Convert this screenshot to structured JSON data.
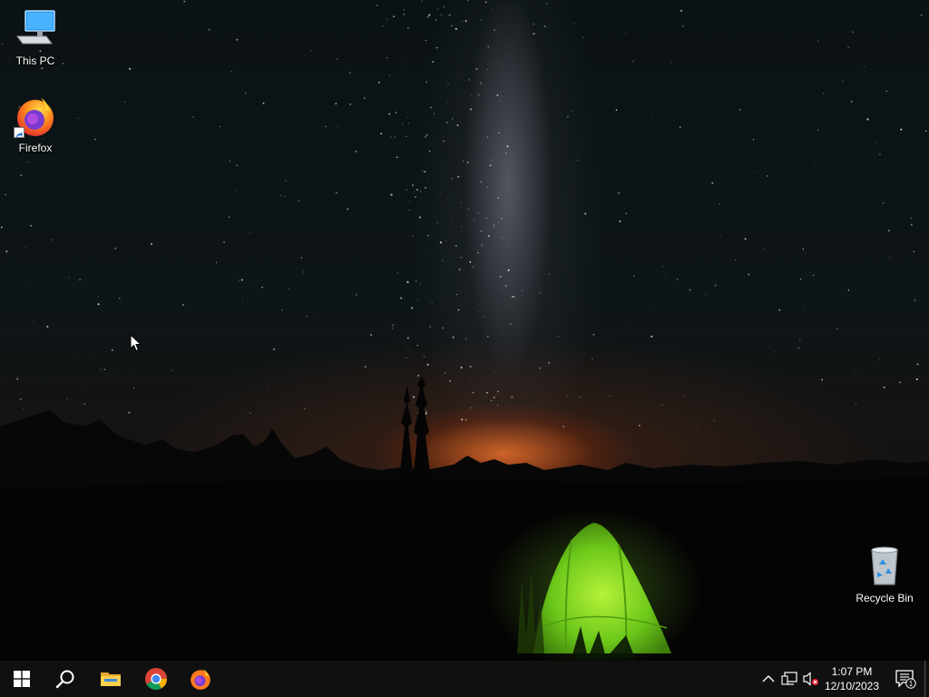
{
  "desktop": {
    "icons": [
      {
        "name": "this-pc",
        "label": "This PC",
        "icon": "computer-icon"
      },
      {
        "name": "firefox",
        "label": "Firefox",
        "icon": "firefox-icon"
      },
      {
        "name": "recycle-bin",
        "label": "Recycle Bin",
        "icon": "recycle-bin-icon"
      }
    ]
  },
  "taskbar": {
    "buttons": [
      {
        "name": "start",
        "icon": "windows-logo-icon"
      },
      {
        "name": "search",
        "icon": "search-icon"
      },
      {
        "name": "file-explorer",
        "icon": "folder-icon"
      },
      {
        "name": "chrome",
        "icon": "chrome-icon"
      },
      {
        "name": "firefox",
        "icon": "firefox-icon"
      }
    ],
    "tray": {
      "icons": [
        "chevron-up-icon",
        "network-icon",
        "volume-muted-icon"
      ],
      "clock": {
        "time": "1:07 PM",
        "date": "12/10/2023"
      },
      "notifications": {
        "icon": "action-center-icon",
        "badge": "1"
      }
    }
  },
  "colors": {
    "taskbar_bg": "#101010",
    "tent_green": "#7fd11a",
    "glow_orange": "#e8702a"
  }
}
